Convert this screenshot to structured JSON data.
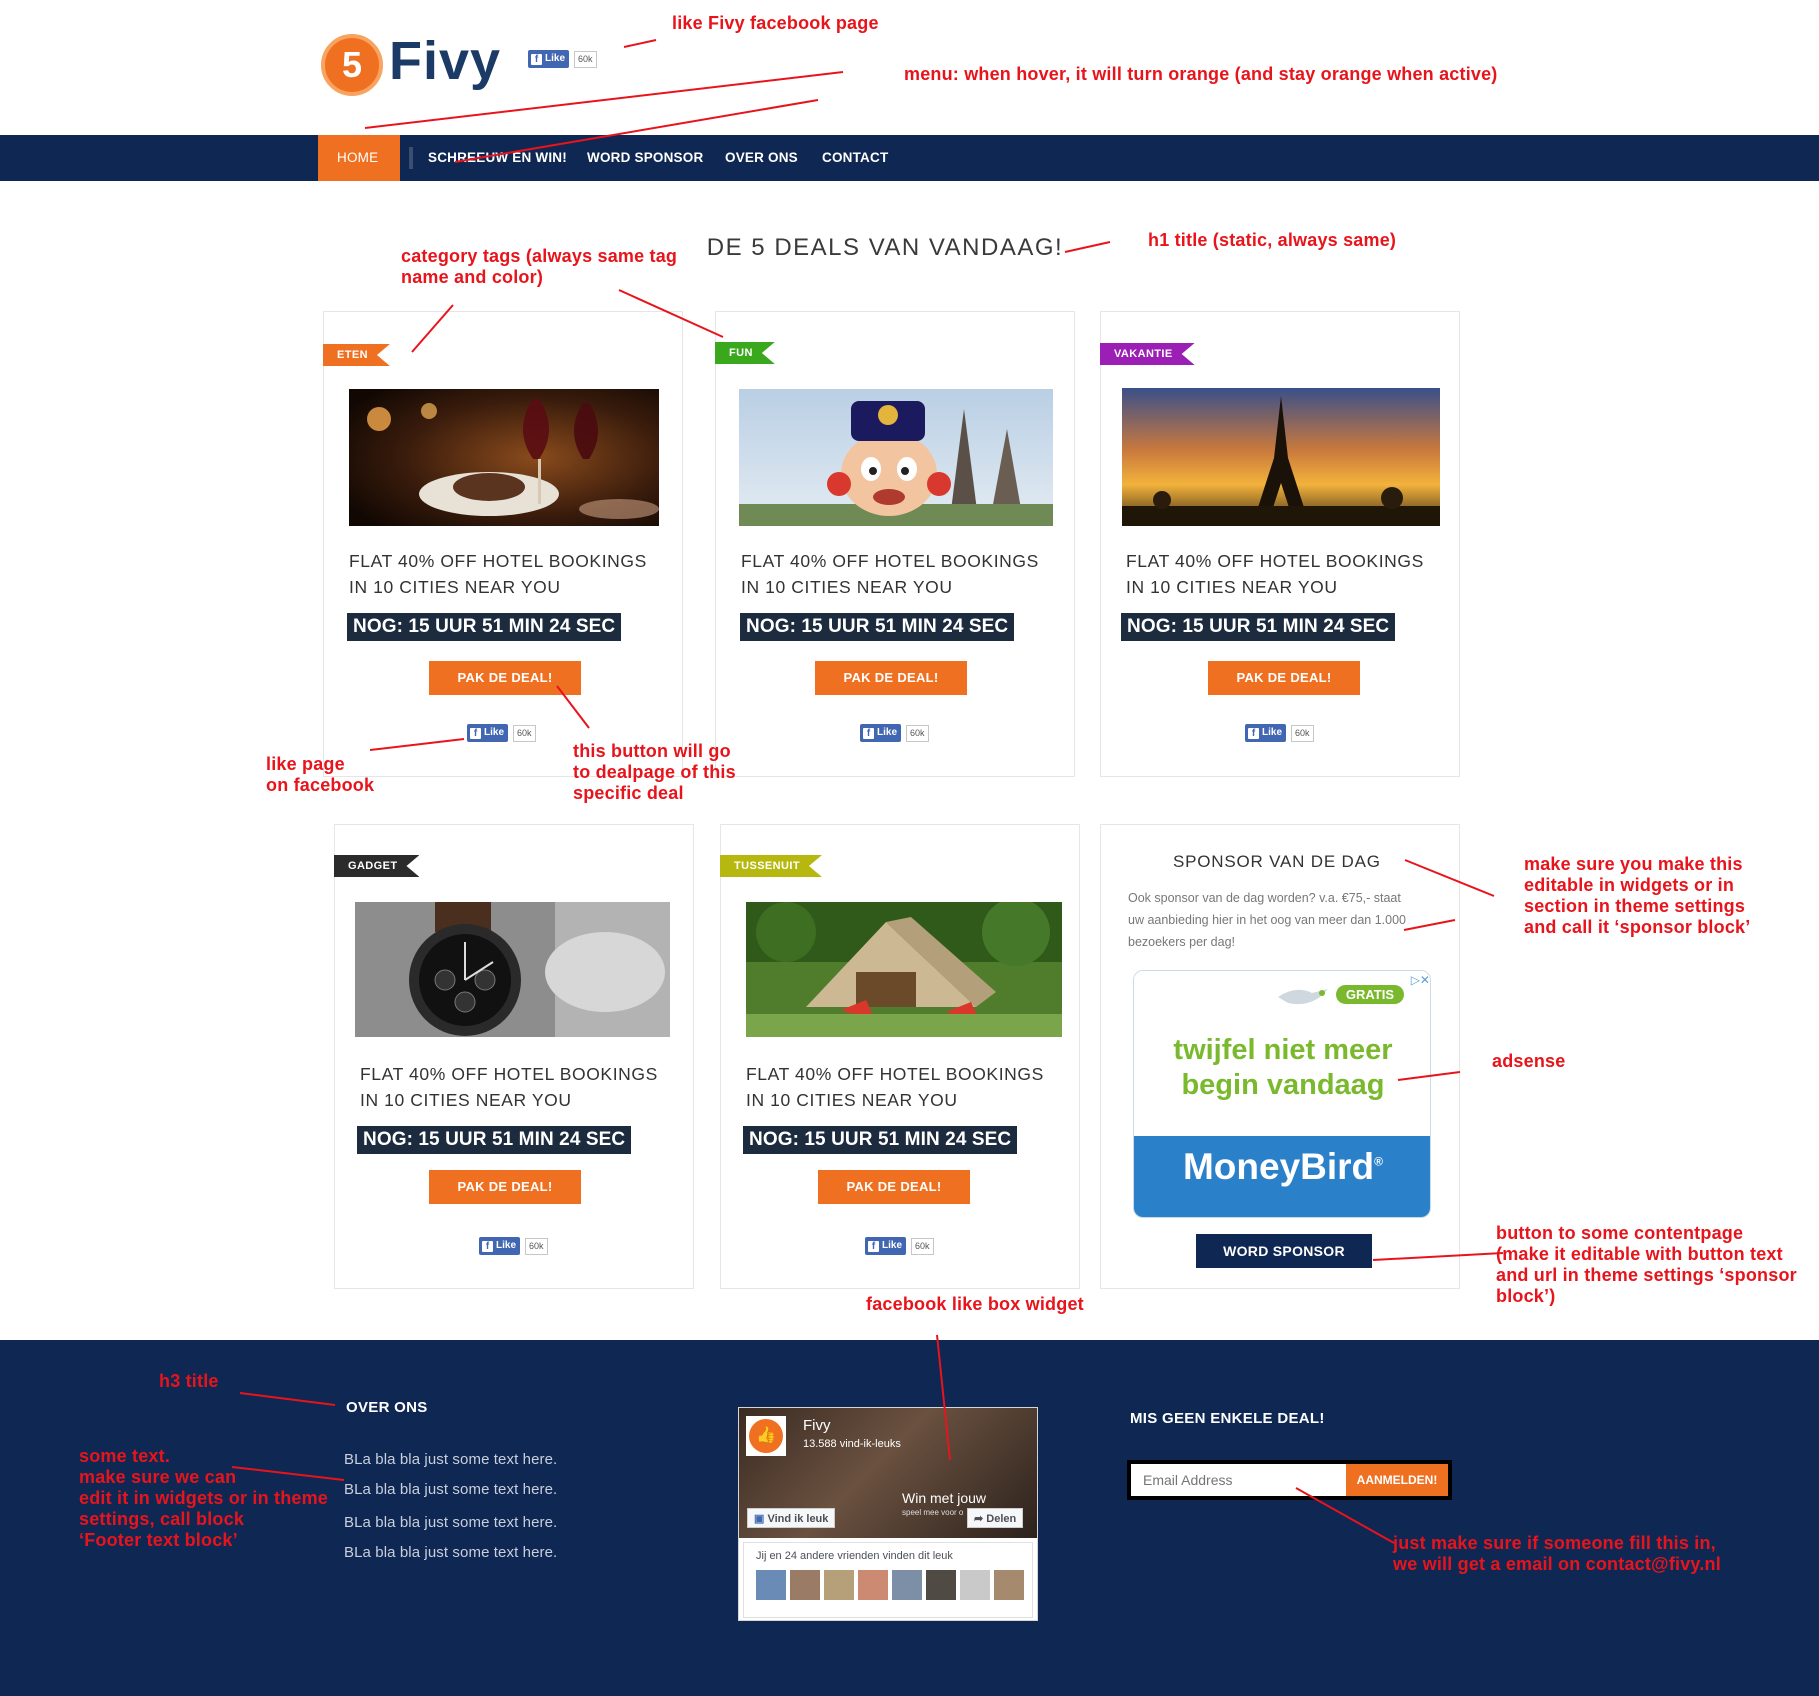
{
  "header": {
    "logo_number": "5",
    "logo_text": "Fivy"
  },
  "fb": {
    "like_label": "Like",
    "like_count": "60k",
    "f": "f"
  },
  "nav": {
    "items": [
      "HOME",
      "SCHREEUW EN WIN!",
      "WORD SPONSOR",
      "OVER ONS",
      "CONTACT"
    ],
    "active": "HOME"
  },
  "main": {
    "title": "DE 5 DEALS VAN VANDAAG!"
  },
  "deals": [
    {
      "tag": "ETEN",
      "tag_color": "#f07021",
      "title_line1": "FLAT 40% OFF HOTEL BOOKINGS",
      "title_line2": "IN 10 CITIES NEAR YOU",
      "countdown": "NOG: 15 UUR 51 MIN 24 SEC",
      "button": "PAK DE DEAL!"
    },
    {
      "tag": "FUN",
      "tag_color": "#3aa81c",
      "title_line1": "FLAT 40% OFF HOTEL BOOKINGS",
      "title_line2": "IN 10 CITIES NEAR YOU",
      "countdown": "NOG: 15 UUR 51 MIN 24 SEC",
      "button": "PAK DE DEAL!"
    },
    {
      "tag": "VAKANTIE",
      "tag_color": "#9b1fb5",
      "title_line1": "FLAT 40% OFF HOTEL BOOKINGS",
      "title_line2": "IN 10 CITIES NEAR YOU",
      "countdown": "NOG: 15 UUR 51 MIN 24 SEC",
      "button": "PAK DE DEAL!"
    },
    {
      "tag": "GADGET",
      "tag_color": "#2b2b2b",
      "title_line1": "FLAT 40% OFF HOTEL BOOKINGS",
      "title_line2": "IN 10 CITIES NEAR YOU",
      "countdown": "NOG: 15 UUR 51 MIN 24 SEC",
      "button": "PAK DE DEAL!"
    },
    {
      "tag": "TUSSENUIT",
      "tag_color": "#b6b80f",
      "title_line1": "FLAT 40% OFF HOTEL BOOKINGS",
      "title_line2": "IN 10 CITIES NEAR YOU",
      "countdown": "NOG: 15 UUR 51 MIN 24 SEC",
      "button": "PAK DE DEAL!"
    }
  ],
  "sponsor": {
    "title": "SPONSOR VAN DE DAG",
    "text_line1": "Ook sponsor van de dag worden? v.a. €75,- staat",
    "text_line2": "uw aanbieding hier in het oog van meer dan 1.000",
    "text_line3": "bezoekers per dag!",
    "ad_gratis": "GRATIS",
    "ad_line1": "twijfel niet meer",
    "ad_line2": "begin vandaag",
    "ad_brand": "MoneyBird",
    "ad_reg": "®",
    "ad_close": "▷✕",
    "button": "WORD SPONSOR"
  },
  "footer": {
    "over_title": "OVER ONS",
    "over_lines": [
      "BLa bla bla just some text here.",
      "BLa bla bla just some text here.",
      "BLa bla bla just some text here.",
      "BLa bla bla just some text here."
    ],
    "fb_page_name": "Fivy",
    "fb_likes": "13.588 vind-ik-leuks",
    "fb_cover_text": "Win met jouw",
    "fb_cover_subtext": "speel mee voor o",
    "fb_like_btn": "Vind ik leuk",
    "fb_share_btn": "Delen",
    "fb_friends_text": "Jij en 24 andere vrienden vinden dit leuk",
    "newsletter_title": "MIS GEEN ENKELE DEAL!",
    "email_placeholder": "Email Address",
    "signup_button": "AANMELDEN!"
  },
  "annotations": {
    "like_fivy": "like Fivy facebook page",
    "menu": "menu: when hover, it will turn orange (and stay orange when active)",
    "h1": "h1 title (static, always same)",
    "category_l1": "category tags (always same tag",
    "category_l2": "name and color)",
    "like_page_l1": "like page",
    "like_page_l2": "on facebook",
    "button_l1": "this button will go",
    "button_l2": "to dealpage of this",
    "button_l3": "specific deal",
    "sponsor_l1": "make sure you make this",
    "sponsor_l2": "editable in widgets or in",
    "sponsor_l3": "section in theme settings",
    "sponsor_l4": "and call it ‘sponsor block’",
    "adsense": "adsense",
    "sbtn_l1": "button to some contentpage",
    "sbtn_l2": "(make it editable with button text",
    "sbtn_l3": "and url in theme settings ‘sponsor",
    "sbtn_l4": "block’)",
    "fbbox": "facebook like box widget",
    "h3": "h3 title",
    "some_l1": "some text.",
    "some_l2": "make sure we can",
    "some_l3": "edit it in widgets or in theme",
    "some_l4": "settings, call block",
    "some_l5": "‘Footer text block’",
    "email_l1": "just make sure if someone fill this in,",
    "email_l2": "we will get a email on contact@fivy.nl"
  },
  "colors": {
    "navy": "#0f2753",
    "orange": "#f07021",
    "annotation_red": "#e8141b"
  }
}
